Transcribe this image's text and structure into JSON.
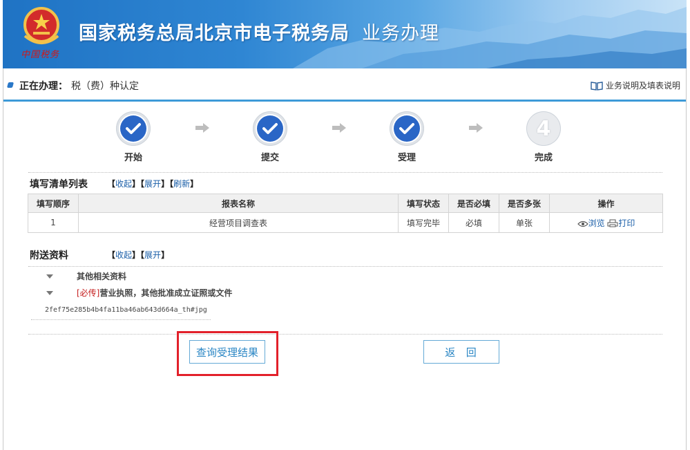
{
  "banner": {
    "title": "国家税务总局北京市电子税务局",
    "subtitle": "业务办理",
    "logo_text": "中国税务"
  },
  "current": {
    "label": "正在办理：",
    "value": "税（费）种认定",
    "help": "业务说明及填表说明"
  },
  "steps": [
    {
      "label": "开始",
      "state": "done"
    },
    {
      "label": "提交",
      "state": "done"
    },
    {
      "label": "受理",
      "state": "done"
    },
    {
      "label": "完成",
      "state": "todo",
      "number": "4"
    }
  ],
  "fill_list": {
    "title": "填写清单列表",
    "links": [
      "收起",
      "展开",
      "刷新"
    ],
    "headers": [
      "填写顺序",
      "报表名称",
      "填写状态",
      "是否必填",
      "是否多张",
      "操作"
    ],
    "rows": [
      {
        "order": "1",
        "name": "经营项目调查表",
        "status": "填写完毕",
        "required": "必填",
        "multi": "单张",
        "op_view": "浏览",
        "op_print": "打印"
      }
    ]
  },
  "attachments": {
    "title": "附送资料",
    "links": [
      "收起",
      "展开"
    ],
    "items": [
      {
        "tag": "",
        "text": "其他相关资料"
      },
      {
        "tag": "[必传]",
        "text": "营业执照，其他批准成立证照或文件"
      }
    ],
    "filename": "2fef75e285b4b4fa11ba46ab643d664a_th#jpg"
  },
  "buttons": {
    "query": "查询受理结果",
    "back": "返  回"
  },
  "colors": {
    "accent": "#2a66c6",
    "link": "#1a5ea8",
    "highlight": "#e2202a",
    "required": "#c41b1b"
  }
}
